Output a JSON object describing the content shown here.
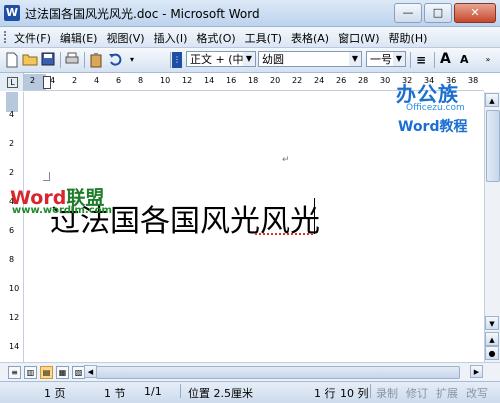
{
  "window": {
    "app_icon": "W",
    "title": "过法国各国风光风光.doc - Microsoft Word",
    "minimize": "—",
    "maximize": "□",
    "close": "✕"
  },
  "menu": {
    "items": [
      "文件(F)",
      "编辑(E)",
      "视图(V)",
      "插入(I)",
      "格式(O)",
      "工具(T)",
      "表格(A)",
      "窗口(W)",
      "帮助(H)"
    ],
    "right_icons": [
      "?",
      "▾",
      "×"
    ]
  },
  "toolbar": {
    "style": "正文 + (中文",
    "font": "幼圆",
    "size": "一号",
    "align_icon": "≡",
    "grow_font": "A",
    "shrink_font": "A",
    "icons": [
      "new-doc-icon",
      "open-folder-icon",
      "save-icon",
      "print-icon",
      "paste-icon",
      "undo-icon"
    ]
  },
  "ruler": {
    "corner_icon": "L",
    "horizontal_ticks": [
      "2",
      "4",
      "2",
      "4",
      "6",
      "8",
      "10",
      "12",
      "14",
      "16",
      "18",
      "20",
      "22",
      "24",
      "26",
      "28",
      "30",
      "32",
      "34",
      "36",
      "38"
    ],
    "vertical_ticks": [
      "4",
      "2",
      "2",
      "4",
      "6",
      "8",
      "10",
      "12",
      "14"
    ]
  },
  "document": {
    "text": "过法国各国风光风光",
    "para_mark": "↵"
  },
  "watermarks": {
    "word_a": "Word",
    "word_b": "联盟",
    "word_url": "www.wordlm.com",
    "brand_name": "办公族",
    "brand_url": "Officezu.com",
    "brand_tutorial": "Word教程"
  },
  "view_buttons": [
    "≡",
    "▥",
    "▤",
    "▦",
    "▧"
  ],
  "status": {
    "page": "1 页",
    "section": "1 节",
    "page_of": "1/1",
    "position": "位置 2.5厘米",
    "line": "1 行",
    "column": "10 列",
    "rec": "录制",
    "trk": "修订",
    "ext": "扩展",
    "ovr": "改写"
  }
}
